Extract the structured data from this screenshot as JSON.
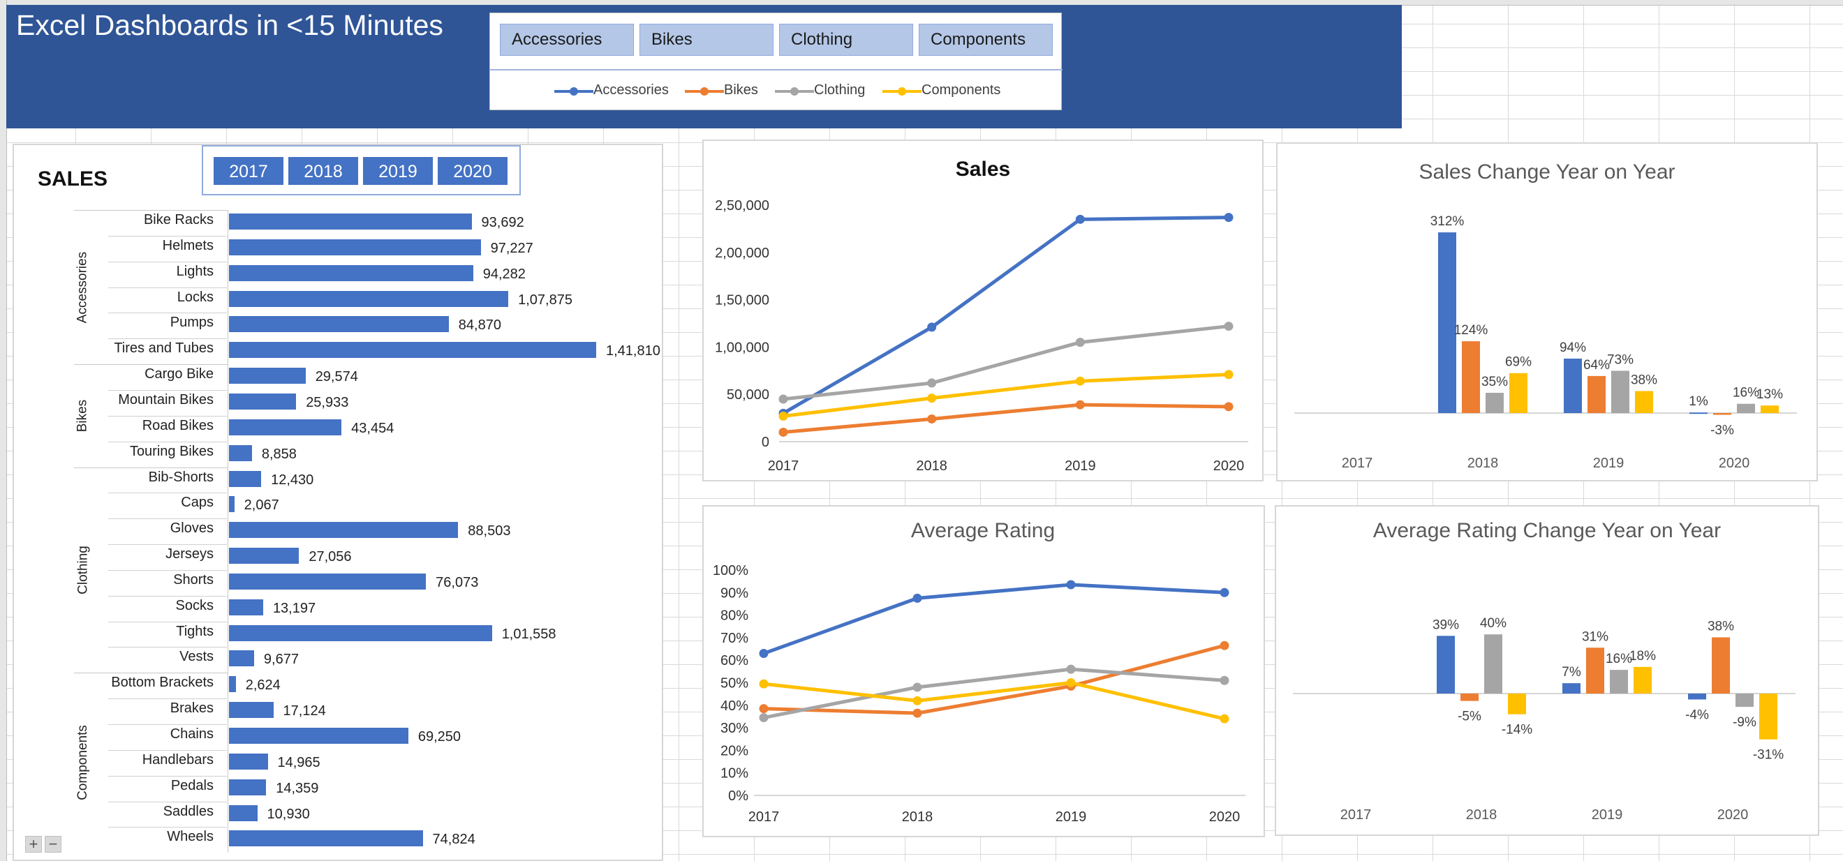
{
  "banner": {
    "title": "Excel Dashboards in <15 Minutes"
  },
  "category_slicer": {
    "buttons": [
      "Accessories",
      "Bikes",
      "Clothing",
      "Components"
    ],
    "legend": [
      {
        "label": "Accessories",
        "color": "#4472c4"
      },
      {
        "label": "Bikes",
        "color": "#ed7d31"
      },
      {
        "label": "Clothing",
        "color": "#a5a5a5"
      },
      {
        "label": "Components",
        "color": "#ffc000"
      }
    ]
  },
  "year_slicer": {
    "buttons": [
      "2017",
      "2018",
      "2019",
      "2020"
    ]
  },
  "sales_panel": {
    "title": "SALES",
    "zoom_in": "+",
    "zoom_out": "−"
  },
  "chart_data": [
    {
      "type": "bar",
      "orientation": "horizontal",
      "title": "SALES",
      "groups": [
        {
          "name": "Accessories",
          "items": [
            {
              "label": "Bike Racks",
              "value": 93692,
              "display": "93,692"
            },
            {
              "label": "Helmets",
              "value": 97227,
              "display": "97,227"
            },
            {
              "label": "Lights",
              "value": 94282,
              "display": "94,282"
            },
            {
              "label": "Locks",
              "value": 107875,
              "display": "1,07,875"
            },
            {
              "label": "Pumps",
              "value": 84870,
              "display": "84,870"
            },
            {
              "label": "Tires and Tubes",
              "value": 141810,
              "display": "1,41,810"
            }
          ]
        },
        {
          "name": "Bikes",
          "items": [
            {
              "label": "Cargo Bike",
              "value": 29574,
              "display": "29,574"
            },
            {
              "label": "Mountain Bikes",
              "value": 25933,
              "display": "25,933"
            },
            {
              "label": "Road Bikes",
              "value": 43454,
              "display": "43,454"
            },
            {
              "label": "Touring Bikes",
              "value": 8858,
              "display": "8,858"
            }
          ]
        },
        {
          "name": "Clothing",
          "items": [
            {
              "label": "Bib-Shorts",
              "value": 12430,
              "display": "12,430"
            },
            {
              "label": "Caps",
              "value": 2067,
              "display": "2,067"
            },
            {
              "label": "Gloves",
              "value": 88503,
              "display": "88,503"
            },
            {
              "label": "Jerseys",
              "value": 27056,
              "display": "27,056"
            },
            {
              "label": "Shorts",
              "value": 76073,
              "display": "76,073"
            },
            {
              "label": "Socks",
              "value": 13197,
              "display": "13,197"
            },
            {
              "label": "Tights",
              "value": 101558,
              "display": "1,01,558"
            },
            {
              "label": "Vests",
              "value": 9677,
              "display": "9,677"
            }
          ]
        },
        {
          "name": "Components",
          "items": [
            {
              "label": "Bottom Brackets",
              "value": 2624,
              "display": "2,624"
            },
            {
              "label": "Brakes",
              "value": 17124,
              "display": "17,124"
            },
            {
              "label": "Chains",
              "value": 69250,
              "display": "69,250"
            },
            {
              "label": "Handlebars",
              "value": 14965,
              "display": "14,965"
            },
            {
              "label": "Pedals",
              "value": 14359,
              "display": "14,359"
            },
            {
              "label": "Saddles",
              "value": 10930,
              "display": "10,930"
            },
            {
              "label": "Wheels",
              "value": 74824,
              "display": "74,824"
            }
          ]
        }
      ],
      "xlim": [
        0,
        145000
      ]
    },
    {
      "type": "line",
      "title": "Sales",
      "x": [
        "2017",
        "2018",
        "2019",
        "2020"
      ],
      "ylim": [
        0,
        250000
      ],
      "yticks": [
        "0",
        "50,000",
        "1,00,000",
        "1,50,000",
        "2,00,000",
        "2,50,000"
      ],
      "series": [
        {
          "name": "Accessories",
          "color": "#4472c4",
          "values": [
            30000,
            121000,
            235000,
            237000
          ]
        },
        {
          "name": "Bikes",
          "color": "#ed7d31",
          "values": [
            10000,
            24000,
            39000,
            37000
          ]
        },
        {
          "name": "Clothing",
          "color": "#a5a5a5",
          "values": [
            45000,
            62000,
            105000,
            122000
          ]
        },
        {
          "name": "Components",
          "color": "#ffc000",
          "values": [
            27000,
            46000,
            64000,
            71000
          ]
        }
      ]
    },
    {
      "type": "bar",
      "title": "Sales Change Year on Year",
      "categories": [
        "2017",
        "2018",
        "2019",
        "2020"
      ],
      "ylim": [
        -0.2,
        3.4
      ],
      "series": [
        {
          "name": "Accessories",
          "color": "#4472c4",
          "values": [
            null,
            3.12,
            0.94,
            0.01
          ],
          "labels": [
            "",
            "312%",
            "94%",
            "1%"
          ]
        },
        {
          "name": "Bikes",
          "color": "#ed7d31",
          "values": [
            null,
            1.24,
            0.64,
            -0.03
          ],
          "labels": [
            "",
            "124%",
            "64%",
            "-3%"
          ]
        },
        {
          "name": "Clothing",
          "color": "#a5a5a5",
          "values": [
            null,
            0.35,
            0.73,
            0.16
          ],
          "labels": [
            "",
            "35%",
            "73%",
            "16%"
          ]
        },
        {
          "name": "Components",
          "color": "#ffc000",
          "values": [
            null,
            0.69,
            0.38,
            0.13
          ],
          "labels": [
            "",
            "69%",
            "38%",
            "13%"
          ]
        }
      ]
    },
    {
      "type": "line",
      "title": "Average Rating",
      "x": [
        "2017",
        "2018",
        "2019",
        "2020"
      ],
      "ylim": [
        0,
        1
      ],
      "yticks": [
        "0%",
        "10%",
        "20%",
        "30%",
        "40%",
        "50%",
        "60%",
        "70%",
        "80%",
        "90%",
        "100%"
      ],
      "series": [
        {
          "name": "Accessories",
          "color": "#4472c4",
          "values": [
            0.63,
            0.875,
            0.935,
            0.9
          ]
        },
        {
          "name": "Bikes",
          "color": "#ed7d31",
          "values": [
            0.385,
            0.365,
            0.485,
            0.665
          ]
        },
        {
          "name": "Clothing",
          "color": "#a5a5a5",
          "values": [
            0.345,
            0.48,
            0.56,
            0.51
          ]
        },
        {
          "name": "Components",
          "color": "#ffc000",
          "values": [
            0.495,
            0.42,
            0.5,
            0.34
          ]
        }
      ]
    },
    {
      "type": "bar",
      "title": "Average Rating Change Year on Year",
      "categories": [
        "2017",
        "2018",
        "2019",
        "2020"
      ],
      "ylim": [
        -0.36,
        0.45
      ],
      "series": [
        {
          "name": "Accessories",
          "color": "#4472c4",
          "values": [
            null,
            0.39,
            0.07,
            -0.04
          ],
          "labels": [
            "",
            "39%",
            "7%",
            "-4%"
          ]
        },
        {
          "name": "Bikes",
          "color": "#ed7d31",
          "values": [
            null,
            -0.05,
            0.31,
            0.38
          ],
          "labels": [
            "",
            "-5%",
            "31%",
            "38%"
          ]
        },
        {
          "name": "Clothing",
          "color": "#a5a5a5",
          "values": [
            null,
            0.4,
            0.16,
            -0.09
          ],
          "labels": [
            "",
            "40%",
            "16%",
            "-9%"
          ]
        },
        {
          "name": "Components",
          "color": "#ffc000",
          "values": [
            null,
            -0.14,
            0.18,
            -0.31
          ],
          "labels": [
            "",
            "-14%",
            "18%",
            "-31%"
          ]
        }
      ]
    }
  ]
}
